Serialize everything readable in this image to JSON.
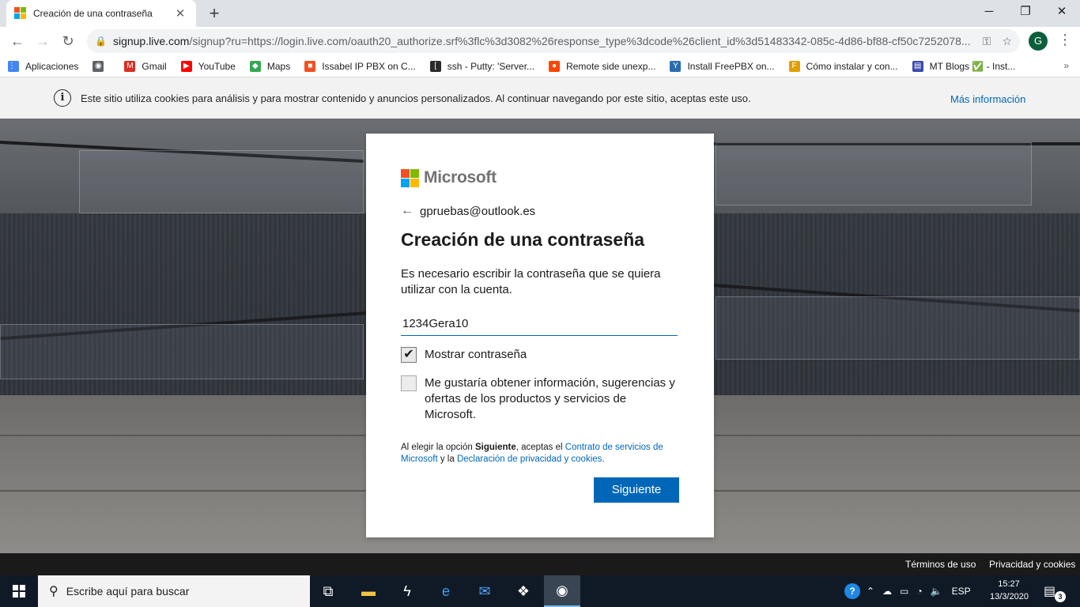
{
  "browser": {
    "tab_title": "Creación de una contraseña",
    "tab_close": "✕",
    "new_tab": "+",
    "window_controls": {
      "minimize": "─",
      "maximize": "❐",
      "close": "✕"
    },
    "url_host": "signup.live.com",
    "url_rest": "/signup?ru=https://login.live.com/oauth20_authorize.srf%3flc%3d3082%26response_type%3dcode%26client_id%3d51483342-085c-4d86-bf88-cf50c7252078...",
    "profile_initial": "G",
    "bookmarks": [
      {
        "label": "Aplicaciones",
        "icon": "apps-grid-icon",
        "color": "#4285f4",
        "glyph": "⋮⋮"
      },
      {
        "label": "",
        "icon": "globe-icon",
        "color": "#5f6368",
        "glyph": "◉"
      },
      {
        "label": "Gmail",
        "icon": "gmail-icon",
        "color": "#d93025",
        "glyph": "M"
      },
      {
        "label": "YouTube",
        "icon": "youtube-icon",
        "color": "#ff0000",
        "glyph": "▶"
      },
      {
        "label": "Maps",
        "icon": "maps-icon",
        "color": "#34a853",
        "glyph": "◆"
      },
      {
        "label": "Issabel IP PBX on C...",
        "icon": "microsoft-icon",
        "color": "#f25022",
        "glyph": "■"
      },
      {
        "label": "ssh - Putty: 'Server...",
        "icon": "bracket-icon",
        "color": "#2a2a2a",
        "glyph": "["
      },
      {
        "label": "Remote side unexp...",
        "icon": "reddit-icon",
        "color": "#ff4500",
        "glyph": "●"
      },
      {
        "label": "Install FreePBX on...",
        "icon": "freepbx-icon",
        "color": "#2b6cb0",
        "glyph": "Y"
      },
      {
        "label": "Cómo instalar y con...",
        "icon": "foss-linux-icon",
        "color": "#e0a100",
        "glyph": "F"
      },
      {
        "label": "MT Blogs ✅ - Inst...",
        "icon": "mt-blogs-icon",
        "color": "#3949ab",
        "glyph": "▤"
      }
    ],
    "bookmarks_more": "»"
  },
  "cookie_bar": {
    "text": "Este sitio utiliza cookies para análisis y para mostrar contenido y anuncios personalizados. Al continuar navegando por este sitio, aceptas este uso.",
    "more_link": "Más información"
  },
  "signup": {
    "brand": "Microsoft",
    "identity": "gpruebas@outlook.es",
    "title": "Creación de una contraseña",
    "description": "Es necesario escribir la contraseña que se quiera utilizar con la cuenta.",
    "password_value": "1234Gera10",
    "show_password_label": "Mostrar contraseña",
    "show_password_checked": true,
    "marketing_label": "Me gustaría obtener información, sugerencias y ofertas de los productos y servicios de Microsoft.",
    "marketing_checked": false,
    "terms_prefix": "Al elegir la opción ",
    "terms_bold": "Siguiente",
    "terms_middle": ", aceptas el ",
    "terms_link1": "Contrato de servicios de Microsoft",
    "terms_and": " y la ",
    "terms_link2": "Declaración de privacidad y cookies",
    "terms_end": ".",
    "next_button": "Siguiente"
  },
  "footer": {
    "terms": "Términos de uso",
    "privacy": "Privacidad y cookies"
  },
  "taskbar": {
    "search_placeholder": "Escribe aquí para buscar",
    "language": "ESP",
    "time": "15:27",
    "date": "13/3/2020",
    "notification_count": "3"
  }
}
